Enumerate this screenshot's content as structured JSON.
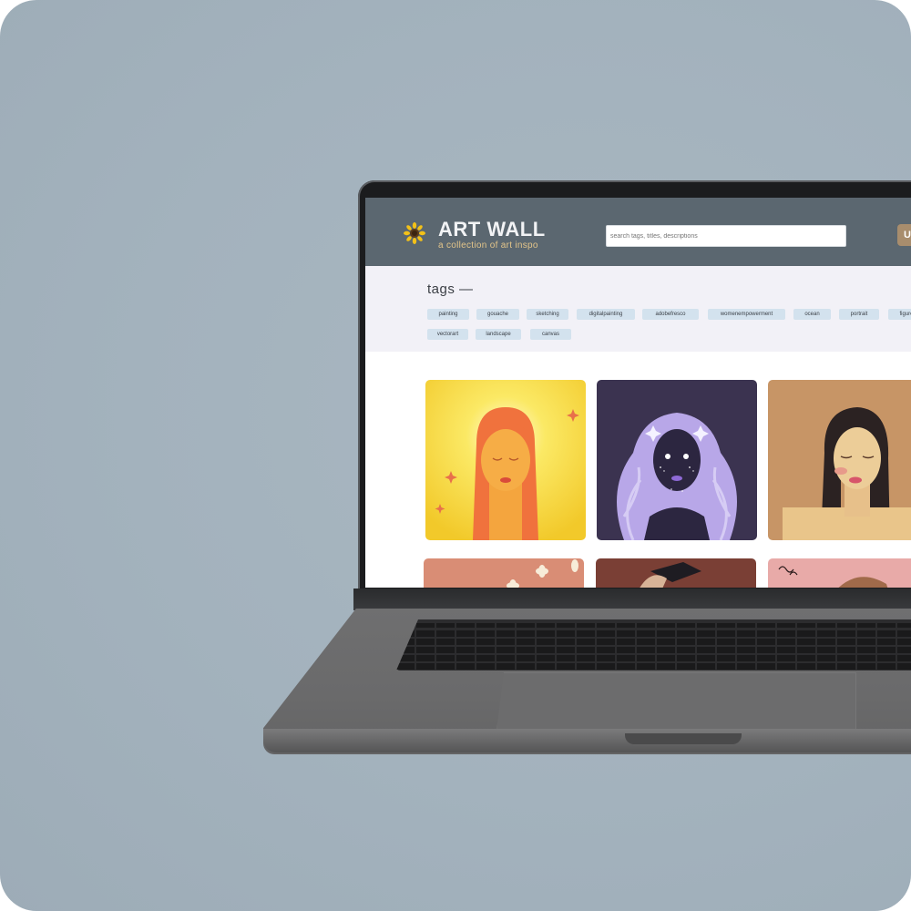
{
  "header": {
    "title": "ART WALL",
    "subtitle": "a collection of art inspo",
    "search_placeholder": "search tags, titles, descriptions",
    "upload_label": "U"
  },
  "tags": {
    "heading": "tags —",
    "items": [
      "painting",
      "gouache",
      "sketching",
      "digitalpainting",
      "adobefresco",
      "womenempowerment",
      "ocean",
      "portrait",
      "figure",
      "vectorart",
      "landscape",
      "canvas"
    ]
  },
  "gallery": {
    "cards": [
      {
        "name": "sun-portrait-artwork",
        "bg": "#f6d53b"
      },
      {
        "name": "galaxy-portrait-artwork",
        "bg": "#3b3350"
      },
      {
        "name": "closed-eyes-portrait-artwork",
        "bg": "#c79566"
      },
      {
        "name": "flowers-artwork",
        "bg": "#d98d75"
      },
      {
        "name": "graduate-artwork",
        "bg": "#7a3f35"
      },
      {
        "name": "pink-portrait-artwork",
        "bg": "#e8aaa8"
      }
    ]
  },
  "colors": {
    "header_bg": "#5b6770",
    "brand_title": "#f2f3f5",
    "brand_subtitle": "#e3c58a",
    "tag_bg": "#d3e2ee",
    "tags_section_bg": "#f2f1f7",
    "upload_button": "#a88d6d",
    "backdrop": "#a3b2bd"
  },
  "icons": [
    "sunflower-logo-icon"
  ]
}
